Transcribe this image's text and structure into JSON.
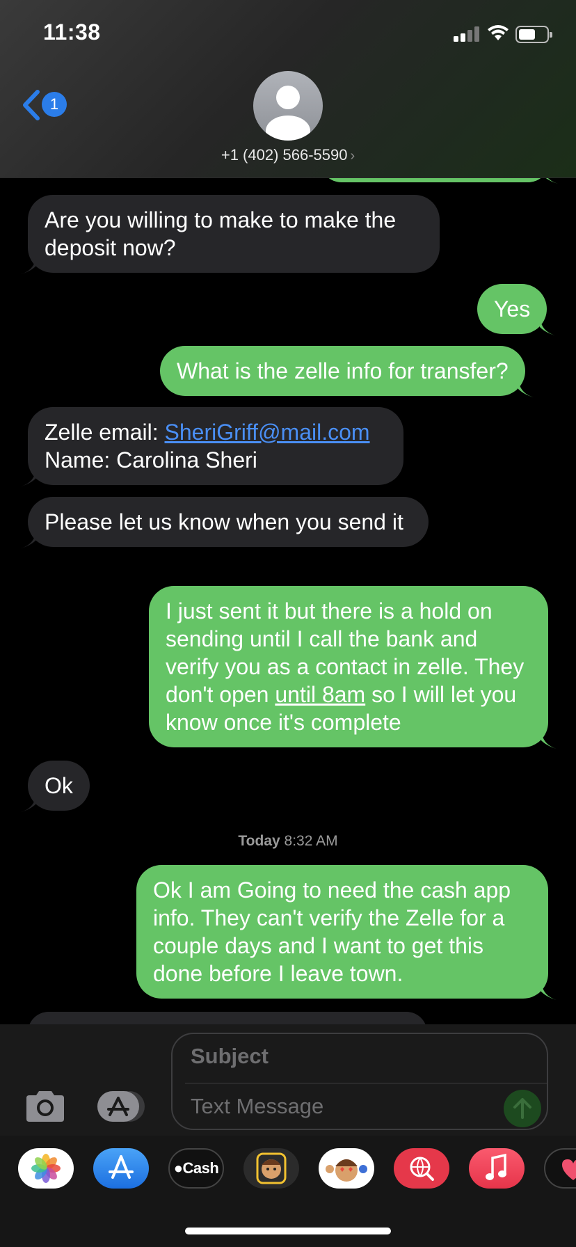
{
  "status_bar": {
    "time": "11:38"
  },
  "header": {
    "back_badge": "1",
    "contact": "+1 (402) 566-5590",
    "contact_chevron": "›"
  },
  "messages": [
    {
      "dir": "in",
      "text": "Are you willing to make to make the deposit now?"
    },
    {
      "dir": "out",
      "text": "Yes"
    },
    {
      "dir": "out",
      "text": "What is the zelle info for transfer?"
    },
    {
      "dir": "in",
      "line1_label": "Zelle email: ",
      "email": "SheriGriff@mail.com",
      "line2": "Name: Carolina Sheri"
    },
    {
      "dir": "in",
      "text": "Please let us know when you send it"
    },
    {
      "dir": "out",
      "text_before": "I just sent it but there is a hold on sending until I call the bank and verify you as a contact in zelle. They don't open ",
      "link_text": "until 8am",
      "text_after": " so I will let you know once it's complete"
    },
    {
      "dir": "in",
      "text": "Ok"
    },
    {
      "dir": "out",
      "text": "Ok I am Going to need the cash app info. They can't verify the Zelle for a couple days and I want to get this done before I leave town."
    }
  ],
  "timestamp": {
    "day": "Today",
    "time": "8:32 AM"
  },
  "composer": {
    "subject_placeholder": "Subject",
    "message_placeholder": "Text Message"
  },
  "app_drawer": [
    {
      "name": "photos-app",
      "label": ""
    },
    {
      "name": "app-store-app",
      "label": ""
    },
    {
      "name": "apple-cash-app",
      "label": "Cash"
    },
    {
      "name": "memoji-app",
      "label": ""
    },
    {
      "name": "memoji-stickers-app",
      "label": ""
    },
    {
      "name": "images-search-app",
      "label": ""
    },
    {
      "name": "music-app",
      "label": ""
    },
    {
      "name": "digital-touch-app",
      "label": ""
    }
  ],
  "colors": {
    "outgoing_bubble": "#65c466",
    "incoming_bubble": "#262629",
    "link": "#4a8ff5",
    "badge": "#2b7de9"
  }
}
